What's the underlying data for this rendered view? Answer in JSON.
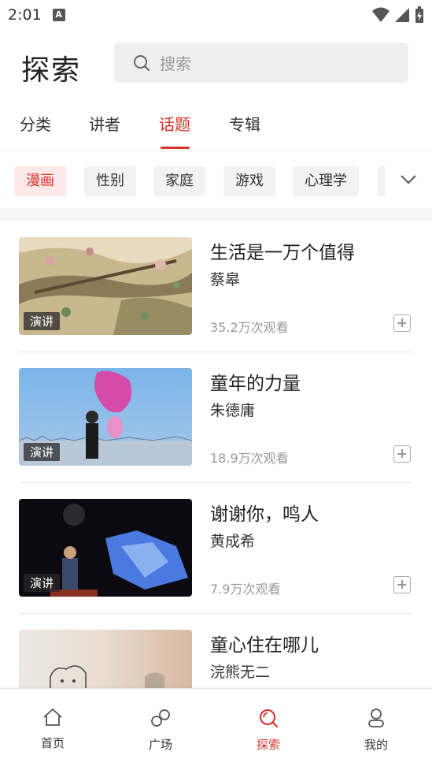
{
  "status_bar": {
    "time": "2:01",
    "notif_letter": "A"
  },
  "header": {
    "title": "探索",
    "search_placeholder": "搜索"
  },
  "tabs": [
    {
      "label": "分类"
    },
    {
      "label": "讲者"
    },
    {
      "label": "话题"
    },
    {
      "label": "专辑"
    }
  ],
  "active_tab": "话题",
  "chips": [
    {
      "label": "漫画"
    },
    {
      "label": "性别"
    },
    {
      "label": "家庭"
    },
    {
      "label": "游戏"
    },
    {
      "label": "心理学"
    }
  ],
  "active_chip": "漫画",
  "talks": [
    {
      "title": "生活是一万个值得",
      "speaker": "蔡皋",
      "views": "35.2万次观看",
      "badge": "演讲"
    },
    {
      "title": "童年的力量",
      "speaker": "朱德庸",
      "views": "18.9万次观看",
      "badge": "演讲"
    },
    {
      "title": "谢谢你，鸣人",
      "speaker": "黄成希",
      "views": "7.9万次观看",
      "badge": "演讲"
    },
    {
      "title": "童心住在哪儿",
      "speaker": "浣熊无二",
      "views": "",
      "badge": ""
    }
  ],
  "bottom_nav": [
    {
      "label": "首页",
      "icon": "home-icon"
    },
    {
      "label": "广场",
      "icon": "link-icon"
    },
    {
      "label": "探索",
      "icon": "explore-search-icon"
    },
    {
      "label": "我的",
      "icon": "profile-icon"
    }
  ],
  "colors": {
    "accent": "#d7322a",
    "chip_active_bg": "#fce9e8",
    "chip_bg": "#f2f2f2",
    "muted": "#999999"
  }
}
